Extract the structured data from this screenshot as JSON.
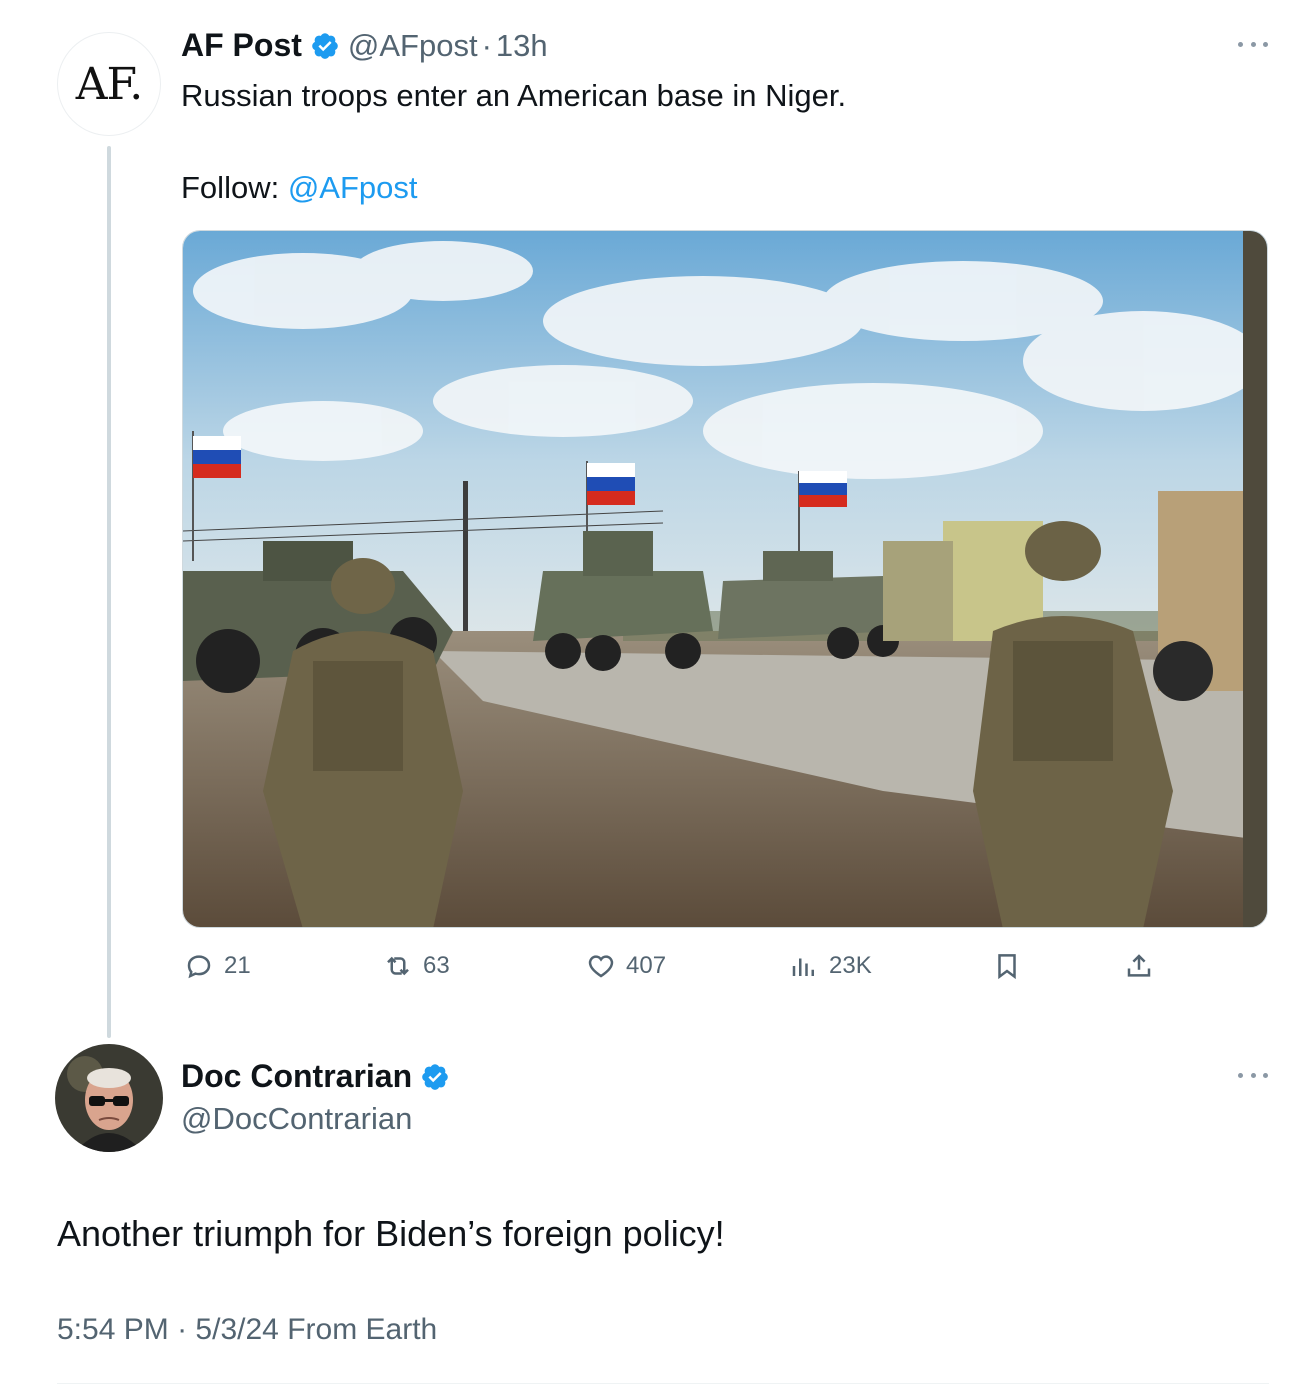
{
  "original_post": {
    "avatar_text": "AF.",
    "display_name": "AF Post",
    "handle": "@AFpost",
    "separator": "·",
    "time": "13h",
    "text": "Russian troops enter an American base in Niger.",
    "follow_label": "Follow: ",
    "follow_handle": "@AFpost",
    "media_icon": "photo-military-convoy",
    "actions": {
      "replies": "21",
      "reposts": "63",
      "likes": "407",
      "views": "23K"
    }
  },
  "reply": {
    "display_name": "Doc Contrarian",
    "handle": "@DocContrarian",
    "text": "Another triumph for Biden’s foreign policy!",
    "time": "5:54 PM",
    "separator": "·",
    "date": "5/3/24",
    "source": "From Earth"
  },
  "colors": {
    "verified": "#1d9bf0",
    "link": "#1d9bf0",
    "secondary_text": "#536471",
    "thread_line": "#cfd9de"
  }
}
